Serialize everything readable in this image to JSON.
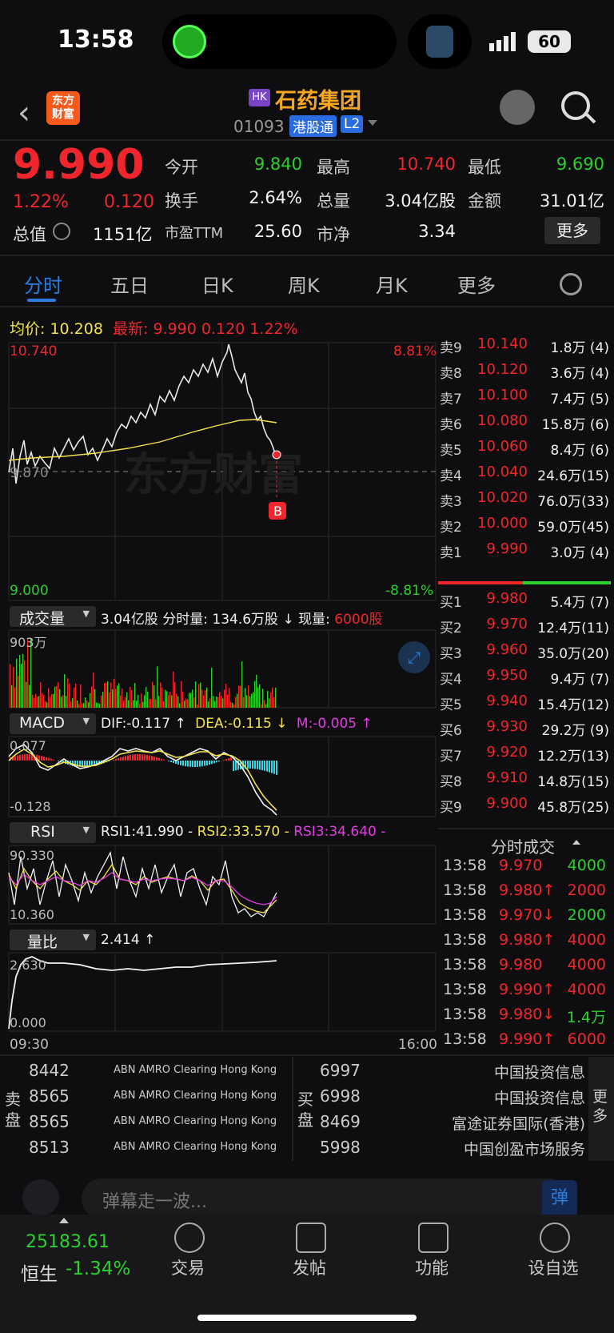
{
  "status_bar": {
    "time": "13:58",
    "battery": "60"
  },
  "header": {
    "back_icon": "chevron-left-icon",
    "logo_line1": "东方",
    "logo_line2": "财富",
    "market_badge": "HK",
    "stock_name": "石药集团",
    "stock_code": "01093",
    "tag_connect": "港股通",
    "tag_level": "L2"
  },
  "quote": {
    "price": "9.990",
    "change_pct": "1.22%",
    "change": "0.120",
    "market_value_label": "总值",
    "market_value": "1151亿",
    "open_label": "今开",
    "open": "9.840",
    "high_label": "最高",
    "high": "10.740",
    "low_label": "最低",
    "low": "9.690",
    "turnover_label": "换手",
    "turnover": "2.64%",
    "volume_label": "总量",
    "volume": "3.04亿股",
    "amount_label": "金额",
    "amount": "31.01亿",
    "pe_label": "市盈TTM",
    "pe": "25.60",
    "pb_label": "市净",
    "pb": "3.34",
    "more_label": "更多"
  },
  "tabs": [
    "分时",
    "五日",
    "日K",
    "周K",
    "月K",
    "更多"
  ],
  "chart_info": {
    "avg_label": "均价:",
    "avg": "10.208",
    "latest_label": "最新:",
    "latest": "9.990",
    "latest_chg": "0.120",
    "latest_pct": "1.22%",
    "y_top": "10.740",
    "y_mid": "9.870",
    "y_bottom": "9.000",
    "pct_top": "8.81%",
    "pct_bottom": "-8.81%",
    "watermark": "东方财富",
    "buy_marker": "B",
    "vol_selector": "成交量",
    "vol_info": "3.04亿股 分时量: 134.6万股 ↓ 现量:",
    "vol_now": "6000股",
    "vol_max": "903万",
    "macd_selector": "MACD",
    "dif": "DIF:-0.117 ↑",
    "dea": "DEA:-0.115 ↓",
    "m": "M:-0.005 ↑",
    "macd_top": "0.077",
    "macd_bottom": "-0.128",
    "rsi_selector": "RSI",
    "rsi1": "RSI1:41.990 -",
    "rsi2": "RSI2:33.570 -",
    "rsi3": "RSI3:34.640 -",
    "rsi_top": "90.330",
    "rsi_bottom": "10.360",
    "lb_selector": "量比",
    "lb_val": "2.414 ↑",
    "lb_top": "2.630",
    "lb_bottom": "0.000",
    "time_start": "09:30",
    "time_end": "16:00"
  },
  "order_book": {
    "asks": [
      {
        "label": "卖9",
        "price": "10.140",
        "vol": "1.8万 (4)"
      },
      {
        "label": "卖8",
        "price": "10.120",
        "vol": "3.6万 (4)"
      },
      {
        "label": "卖7",
        "price": "10.100",
        "vol": "7.4万 (5)"
      },
      {
        "label": "卖6",
        "price": "10.080",
        "vol": "15.8万 (6)"
      },
      {
        "label": "卖5",
        "price": "10.060",
        "vol": "8.4万 (6)"
      },
      {
        "label": "卖4",
        "price": "10.040",
        "vol": "24.6万(15)"
      },
      {
        "label": "卖3",
        "price": "10.020",
        "vol": "76.0万(33)"
      },
      {
        "label": "卖2",
        "price": "10.000",
        "vol": "59.0万(45)"
      },
      {
        "label": "卖1",
        "price": "9.990",
        "vol": "3.0万 (4)"
      }
    ],
    "bids": [
      {
        "label": "买1",
        "price": "9.980",
        "vol": "5.4万 (7)"
      },
      {
        "label": "买2",
        "price": "9.970",
        "vol": "12.4万(11)"
      },
      {
        "label": "买3",
        "price": "9.960",
        "vol": "35.0万(20)"
      },
      {
        "label": "买4",
        "price": "9.950",
        "vol": "9.4万 (7)"
      },
      {
        "label": "买5",
        "price": "9.940",
        "vol": "15.4万(12)"
      },
      {
        "label": "买6",
        "price": "9.930",
        "vol": "29.2万 (9)"
      },
      {
        "label": "买7",
        "price": "9.920",
        "vol": "12.2万(13)"
      },
      {
        "label": "买8",
        "price": "9.910",
        "vol": "14.8万(15)"
      },
      {
        "label": "买9",
        "price": "9.900",
        "vol": "45.8万(25)"
      }
    ]
  },
  "ticks_title": "分时成交",
  "ticks": [
    {
      "time": "13:58",
      "price": "9.970",
      "dir": "",
      "vol": "4000",
      "pc": "red",
      "vc": "green"
    },
    {
      "time": "13:58",
      "price": "9.980↑",
      "dir": "",
      "vol": "2000",
      "pc": "red",
      "vc": "red"
    },
    {
      "time": "13:58",
      "price": "9.970↓",
      "dir": "",
      "vol": "2000",
      "pc": "red",
      "vc": "green"
    },
    {
      "time": "13:58",
      "price": "9.980↑",
      "dir": "",
      "vol": "4000",
      "pc": "red",
      "vc": "red"
    },
    {
      "time": "13:58",
      "price": "9.980",
      "dir": "",
      "vol": "4000",
      "pc": "red",
      "vc": "red"
    },
    {
      "time": "13:58",
      "price": "9.990↑",
      "dir": "",
      "vol": "4000",
      "pc": "red",
      "vc": "red"
    },
    {
      "time": "13:58",
      "price": "9.980↓",
      "dir": "",
      "vol": "1.4万",
      "pc": "red",
      "vc": "green"
    },
    {
      "time": "13:58",
      "price": "9.990↑",
      "dir": "",
      "vol": "6000",
      "pc": "red",
      "vc": "red"
    }
  ],
  "broker_queue": {
    "sell_label": "卖盘",
    "buy_label": "买盘",
    "more_label": "更多",
    "sell": [
      {
        "id": "8442",
        "name": "ABN AMRO Clearing Hong Kong"
      },
      {
        "id": "8565",
        "name": "ABN AMRO Clearing Hong Kong"
      },
      {
        "id": "8565",
        "name": "ABN AMRO Clearing Hong Kong"
      },
      {
        "id": "8513",
        "name": "ABN AMRO Clearing Hong Kong"
      }
    ],
    "buy": [
      {
        "id": "6997",
        "name": "中国投资信息"
      },
      {
        "id": "6998",
        "name": "中国投资信息"
      },
      {
        "id": "8469",
        "name": "富途证券国际(香港)"
      },
      {
        "id": "5998",
        "name": "中国创盈市场服务"
      }
    ]
  },
  "danmu": {
    "placeholder": "弹幕走一波...",
    "button": "弹"
  },
  "bottom_nav": {
    "index_value": "25183.61",
    "index_name": "恒生",
    "index_pct": "-1.34%",
    "items": [
      "交易",
      "发帖",
      "功能",
      "设自选"
    ]
  },
  "colors": {
    "up": "#f0262c",
    "down": "#2bd02e",
    "accent": "#2a7de0",
    "avg_line": "#f3e34a"
  }
}
